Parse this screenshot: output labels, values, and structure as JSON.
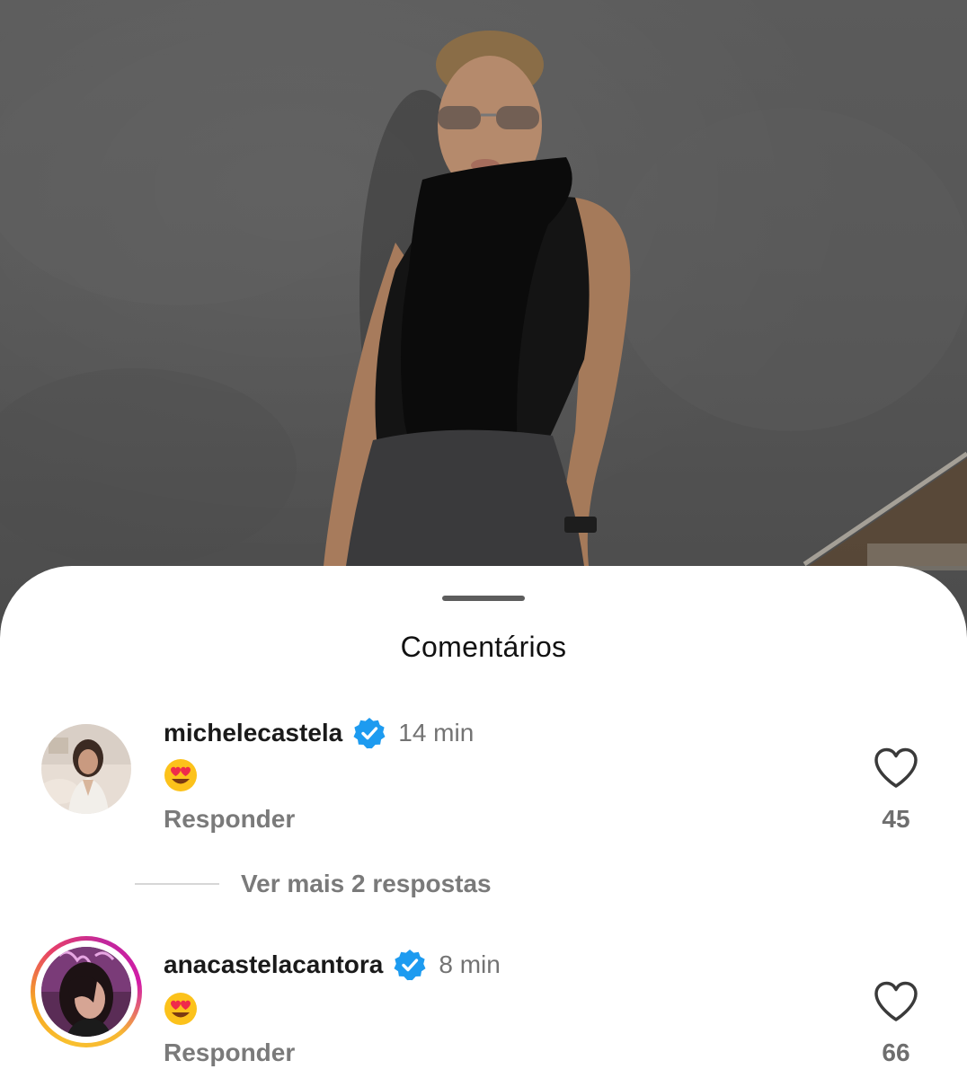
{
  "sheet": {
    "title": "Comentários"
  },
  "comments": [
    {
      "username": "michelecastela",
      "verified": true,
      "time": "14 min",
      "text_emoji": "heart-eyes-emoji",
      "reply_label": "Responder",
      "likes": "45"
    },
    {
      "username": "anacastelacantora",
      "verified": true,
      "time": "8 min",
      "text_emoji": "heart-eyes-emoji",
      "reply_label": "Responder",
      "likes": "66",
      "has_story_ring": true
    }
  ],
  "more_replies": {
    "label": "Ver mais 2 respostas"
  },
  "colors": {
    "verified_blue": "#1d9bf0",
    "sheet_bg": "#ffffff",
    "secondary_text": "#737373"
  },
  "icons": [
    "verified-badge-icon",
    "heart-outline-icon",
    "heart-eyes-emoji"
  ]
}
